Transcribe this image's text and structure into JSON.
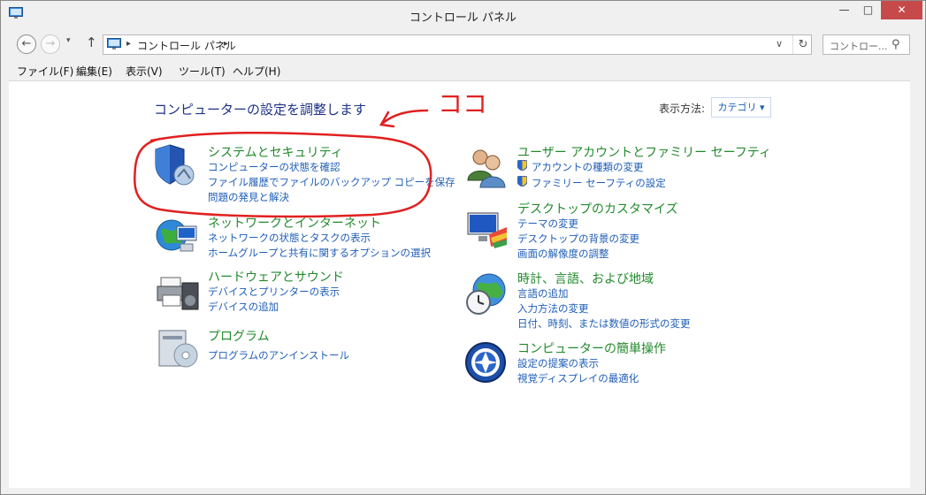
{
  "window": {
    "title": "コントロール パネル",
    "min_label": "—",
    "max_label": "□",
    "close_label": "✕"
  },
  "nav": {
    "back_icon": "←",
    "forward_icon": "→",
    "recent_icon": "▾",
    "up_icon": "↑",
    "breadcrumb": "コントロール パネル",
    "sep1": "▸",
    "sep2": "▸",
    "dropdown_icon": "∨",
    "refresh_icon": "↻",
    "search_placeholder": "コントロー...",
    "search_icon": "⚲"
  },
  "menu": [
    "ファイル(F)",
    "編集(E)",
    "表示(V)",
    "ツール(T)",
    "ヘルプ(H)"
  ],
  "main": {
    "heading": "コンピューターの設定を調整します",
    "view_by_label": "表示方法:",
    "view_by_value": "カテゴリ ▾"
  },
  "categories": {
    "system": {
      "title": "システムとセキュリティ",
      "links": [
        "コンピューターの状態を確認",
        "ファイル履歴でファイルのバックアップ コピーを保存",
        "問題の発見と解決"
      ]
    },
    "network": {
      "title": "ネットワークとインターネット",
      "links": [
        "ネットワークの状態とタスクの表示",
        "ホームグループと共有に関するオプションの選択"
      ]
    },
    "hardware": {
      "title": "ハードウェアとサウンド",
      "links": [
        "デバイスとプリンターの表示",
        "デバイスの追加"
      ]
    },
    "programs": {
      "title": "プログラム",
      "links": [
        "プログラムのアンインストール"
      ]
    },
    "user": {
      "title": "ユーザー アカウントとファミリー セーフティ",
      "links": [
        "アカウントの種類の変更",
        "ファミリー セーフティの設定"
      ]
    },
    "appearance": {
      "title": "デスクトップのカスタマイズ",
      "links": [
        "テーマの変更",
        "デスクトップの背景の変更",
        "画面の解像度の調整"
      ]
    },
    "clock": {
      "title": "時計、言語、および地域",
      "links": [
        "言語の追加",
        "入力方法の変更",
        "日付、時刻、または数値の形式の変更"
      ]
    },
    "ease": {
      "title": "コンピューターの簡単操作",
      "links": [
        "設定の提案の表示",
        "視覚ディスプレイの最適化"
      ]
    }
  },
  "annotation": {
    "text": "ココ",
    "color": "#e0201f"
  },
  "colors": {
    "title_green": "#228a2c",
    "link_blue": "#1f5eb8",
    "heading_blue": "#1e3287",
    "close_red": "#c74a4a"
  }
}
